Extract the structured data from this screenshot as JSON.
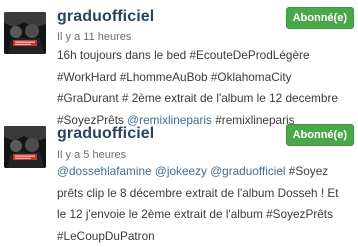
{
  "posts": [
    {
      "username": "graduofficiel",
      "time": "Il y a 11 heures",
      "follow_label": "Abonné(e)",
      "caption_lines": [
        [
          {
            "text": "16h toujours dans le bed #EcouteDeProdLégère",
            "type": "text"
          }
        ],
        [
          {
            "text": "#WorkHard #LhommeAuBob #OklahomaCity",
            "type": "text"
          }
        ],
        [
          {
            "text": "#GraDurant # 2ème extrait de l'album le 12 decembre",
            "type": "text"
          }
        ],
        [
          {
            "text": "#SoyezPrêts ",
            "type": "text"
          },
          {
            "text": "@remixlineparis",
            "type": "mention"
          },
          {
            "text": " #remixlineparis",
            "type": "text"
          }
        ]
      ],
      "avatar_icon": "artist-album-cover"
    },
    {
      "username": "graduofficiel",
      "time": "Il y a 5 heures",
      "follow_label": "Abonné(e)",
      "caption_lines": [
        [
          {
            "text": "@dossehlafamine",
            "type": "mention"
          },
          {
            "text": " ",
            "type": "text"
          },
          {
            "text": "@jokeezy",
            "type": "mention"
          },
          {
            "text": " ",
            "type": "text"
          },
          {
            "text": "@graduofficiel",
            "type": "mention"
          },
          {
            "text": " #Soyez",
            "type": "text"
          }
        ],
        [
          {
            "text": "prêts clip le 8 décembre extrait de l'album Dosseh ! Et",
            "type": "text"
          }
        ],
        [
          {
            "text": "le 12 j'envoie le 2ème extrait de l'album #SoyezPrêts",
            "type": "text"
          }
        ],
        [
          {
            "text": "#LeCoupDuPatron",
            "type": "text"
          }
        ]
      ],
      "avatar_icon": "artist-album-cover"
    }
  ],
  "colors": {
    "username": "#2a4560",
    "mention": "#3d6e96",
    "follow_button": "#4aa84a",
    "avatar_accent": "#c0392b"
  }
}
